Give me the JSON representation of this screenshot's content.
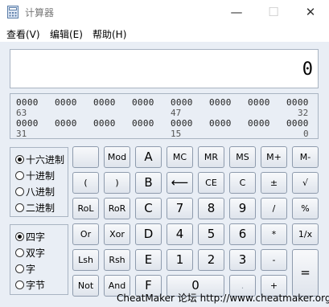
{
  "window": {
    "title": "计算器",
    "minimize_glyph": "—",
    "maximize_glyph": "☐",
    "close_glyph": "✕"
  },
  "menu": {
    "items": [
      "查看(V)",
      "编辑(E)",
      "帮助(H)"
    ]
  },
  "display": {
    "value": "0"
  },
  "bits": {
    "row1": [
      "0000",
      "0000",
      "0000",
      "0000",
      "0000",
      "0000",
      "0000",
      "0000"
    ],
    "row1_index": [
      "63",
      "47",
      "32"
    ],
    "row2": [
      "0000",
      "0000",
      "0000",
      "0000",
      "0000",
      "0000",
      "0000",
      "0000"
    ],
    "row2_index": [
      "31",
      "15",
      "0"
    ]
  },
  "base": {
    "options": [
      "十六进制",
      "十进制",
      "八进制",
      "二进制"
    ],
    "selected": 0
  },
  "word": {
    "options": [
      "四字",
      "双字",
      "字",
      "字节"
    ],
    "selected": 0
  },
  "buttons": [
    [
      "",
      "Mod",
      "A",
      "MC",
      "MR",
      "MS",
      "M+",
      "M-"
    ],
    [
      "(",
      ")",
      "B",
      "⟵",
      "CE",
      "C",
      "±",
      "√"
    ],
    [
      "RoL",
      "RoR",
      "C",
      "7",
      "8",
      "9",
      "/",
      "%"
    ],
    [
      "Or",
      "Xor",
      "D",
      "4",
      "5",
      "6",
      "*",
      "1/x"
    ],
    [
      "Lsh",
      "Rsh",
      "E",
      "1",
      "2",
      "3",
      "-",
      "="
    ],
    [
      "Not",
      "And",
      "F",
      "0",
      ".",
      "+"
    ]
  ],
  "watermark": "CheatMaker 论坛 http://www.cheatmaker.org/"
}
